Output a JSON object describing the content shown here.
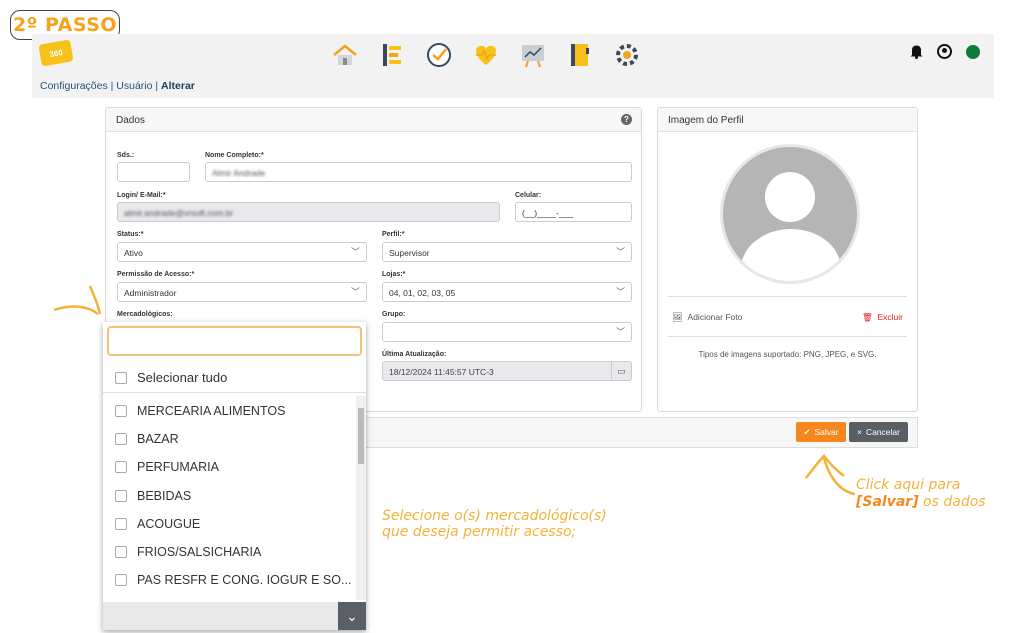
{
  "step_badge": "2º PASSO",
  "logo_text": "360",
  "nav_icons": [
    "home-icon",
    "list-icon",
    "check-icon",
    "health-heart-icon",
    "chart-board-icon",
    "notebook-icon",
    "settings-network-icon"
  ],
  "breadcrumb": {
    "path": "Configurações | Usuário | ",
    "current": "Alterar"
  },
  "dados": {
    "title": "Dados",
    "help": "?",
    "sds_label": "Sds.:",
    "sds_value": "",
    "nome_label": "Nome Completo:*",
    "nome_value": "Almir Andrade",
    "login_label": "Login/ E-Mail:*",
    "login_value": "almir.andrade@vrsoft.com.br",
    "celular_label": "Celular:",
    "celular_value": "(__)____-___",
    "status_label": "Status:*",
    "status_value": "Ativo",
    "perfil_label": "Perfil:*",
    "perfil_value": "Supervisor",
    "permissao_label": "Permissão de Acesso:*",
    "permissao_value": "Administrador",
    "lojas_label": "Lojas:*",
    "lojas_value": "04, 01, 02, 03, 05",
    "mercadologicos_label": "Mercadológicos:",
    "grupo_label": "Grupo:",
    "grupo_value": "",
    "ultima_label": "Última Atualização:",
    "ultima_value": "18/12/2024 11:45:57 UTC-3"
  },
  "perfil": {
    "title": "Imagem do Perfil",
    "add_photo": "Adicionar Foto",
    "delete": "Excluir",
    "types": "Tipos de imagens suportado: PNG, JPEG, e SVG."
  },
  "buttons": {
    "save": "Salvar",
    "cancel": "Cancelar"
  },
  "dropdown": {
    "search_value": "",
    "select_all": "Selecionar tudo",
    "items": [
      "MERCEARIA ALIMENTOS",
      "BAZAR",
      "PERFUMARIA",
      "BEBIDAS",
      "ACOUGUE",
      "FRIOS/SALSICHARIA",
      "PAS RESFR E CONG. IOGUR E SO..."
    ]
  },
  "annotations": {
    "select_line1": "Selecione o(s) mercadológico(s)",
    "select_line2": "que deseja permitir acesso;",
    "save_line1": "Click aqui para",
    "save_bold": "[Salvar]",
    "save_rest": " os dados"
  },
  "colors": {
    "accent": "#f7861d",
    "annotation": "#f5b23a",
    "status_ok": "#0f7a3a"
  }
}
